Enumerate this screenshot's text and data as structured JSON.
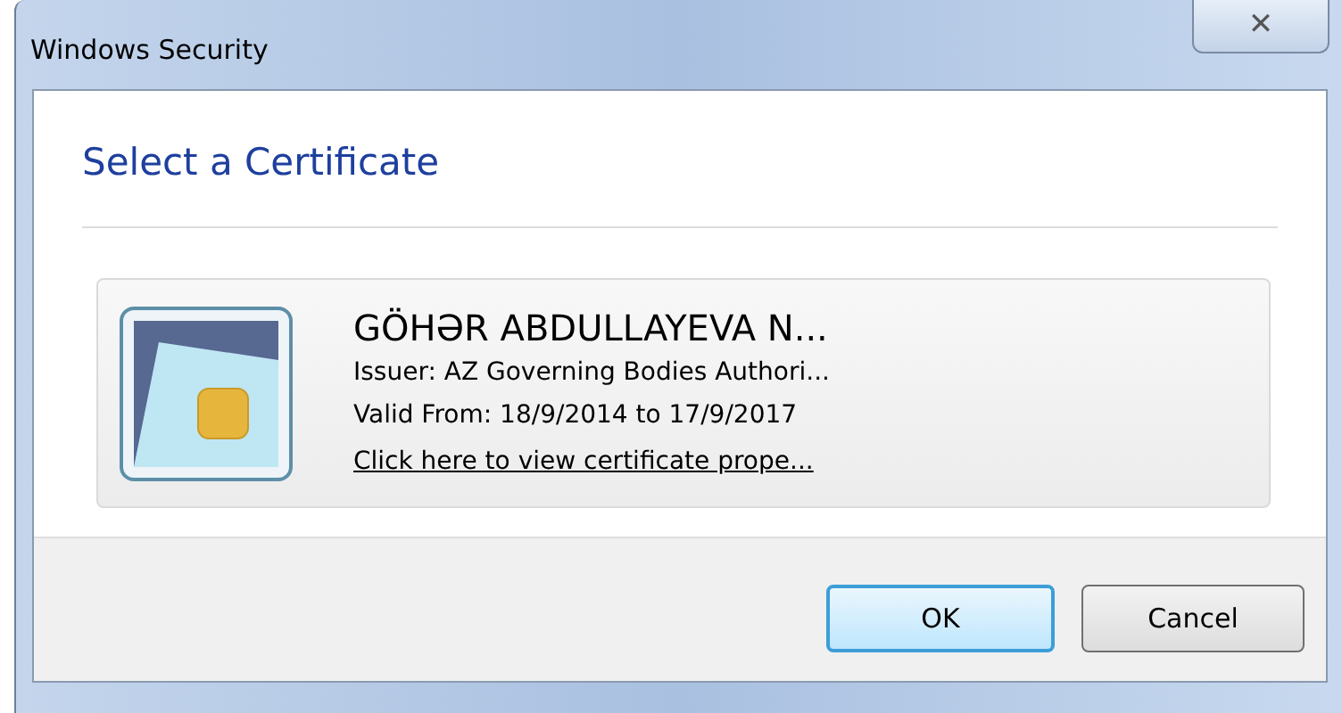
{
  "window": {
    "title": "Windows Security",
    "close": "✕"
  },
  "heading": "Select a Certificate",
  "certificate": {
    "name": "GÖHƏR ABDULLAYEVA N...",
    "issuer": "Issuer: AZ Governing Bodies Authori...",
    "valid": "Valid From: 18/9/2014 to 17/9/2017",
    "link": "Click here to view certificate prope..."
  },
  "buttons": [
    {
      "label": "OK",
      "default": true
    },
    {
      "label": "Cancel",
      "default": false
    }
  ]
}
